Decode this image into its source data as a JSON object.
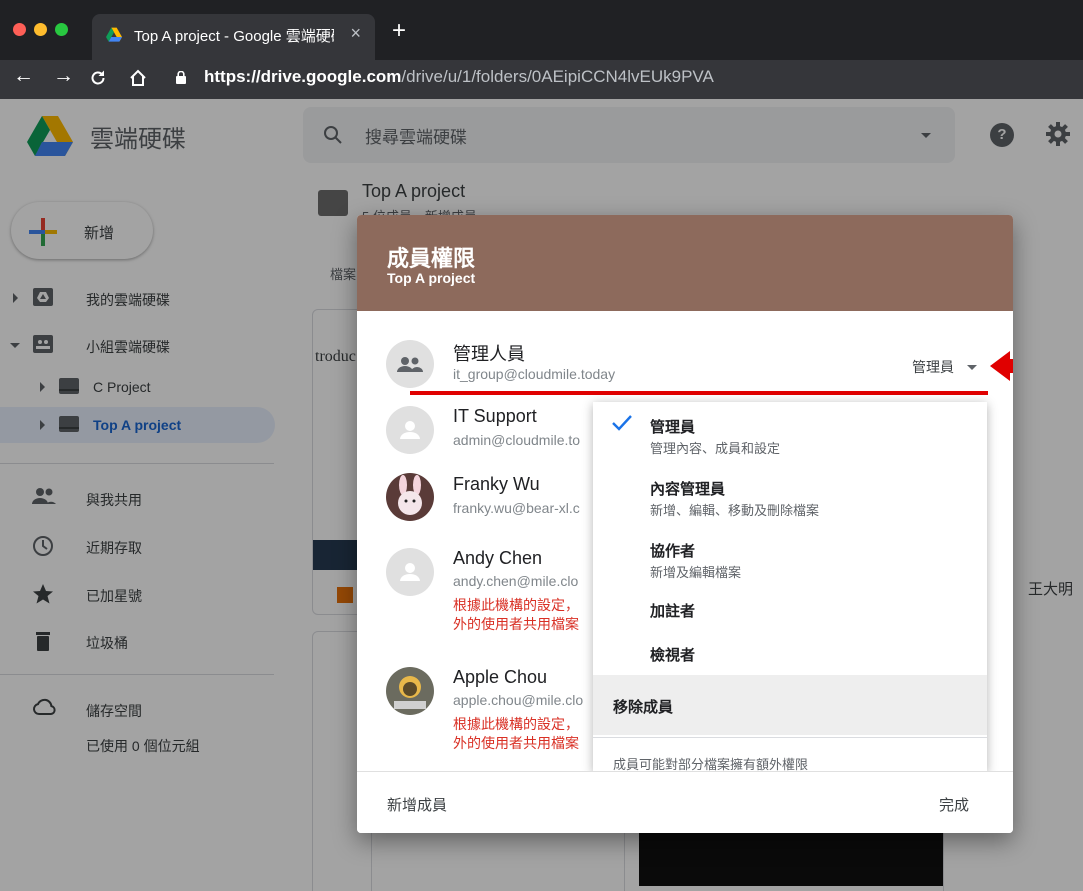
{
  "browser": {
    "tab_title": "Top A project - Google 雲端硬碟",
    "url_host": "https://drive.google.com",
    "url_path": "/drive/u/1/folders/0AEipiCCN4lvEUk9PVA"
  },
  "app": {
    "brand": "雲端硬碟",
    "search_placeholder": "搜尋雲端硬碟",
    "new_button": "新增"
  },
  "sidebar": {
    "items": [
      {
        "label": "我的雲端硬碟"
      },
      {
        "label": "小組雲端硬碟"
      },
      {
        "label": "C Project"
      },
      {
        "label": "Top A project"
      },
      {
        "label": "與我共用"
      },
      {
        "label": "近期存取"
      },
      {
        "label": "已加星號"
      },
      {
        "label": "垃圾桶"
      },
      {
        "label": "儲存空間"
      }
    ],
    "storage_used": "已使用 0 個位元組"
  },
  "folder": {
    "title": "Top A project",
    "subtitle": "5 位成員，新增成員",
    "tab_partial": "檔案",
    "card_text_partial": "troduc",
    "owner_partial": "王大明"
  },
  "dialog": {
    "title": "成員權限",
    "subtitle": "Top A project",
    "members": [
      {
        "name": "管理人員",
        "email": "it_group@cloudmile.today",
        "role": "管理員"
      },
      {
        "name": "IT Support",
        "email": "admin@cloudmile.to"
      },
      {
        "name": "Franky Wu",
        "email": "franky.wu@bear-xl.c"
      },
      {
        "name": "Andy Chen",
        "email": "andy.chen@mile.clo",
        "warning_1": "根據此機構的設定，",
        "warning_2": "外的使用者共用檔案"
      },
      {
        "name": "Apple Chou",
        "email": "apple.chou@mile.clo",
        "warning_1": "根據此機構的設定，",
        "warning_2": "外的使用者共用檔案"
      }
    ],
    "footer_add": "新增成員",
    "footer_done": "完成"
  },
  "menu": {
    "options": [
      {
        "title": "管理員",
        "desc": "管理內容、成員和設定",
        "checked": true
      },
      {
        "title": "內容管理員",
        "desc": "新增、編輯、移動及刪除檔案"
      },
      {
        "title": "協作者",
        "desc": "新增及編輯檔案"
      },
      {
        "title": "加註者",
        "desc": ""
      },
      {
        "title": "檢視者",
        "desc": ""
      }
    ],
    "remove": "移除成員",
    "note": "成員可能對部分檔案擁有額外權限"
  },
  "colors": {
    "dialog_header": "#8d6a5c",
    "accent_blue": "#1a73e8",
    "annotation_red": "#e00000",
    "warning_red": "#d93025"
  }
}
